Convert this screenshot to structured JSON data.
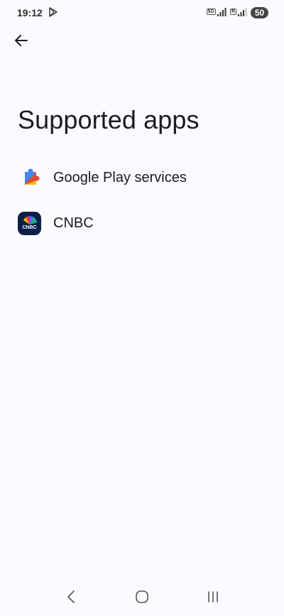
{
  "status_bar": {
    "time": "19:12",
    "network_tag_1": "5G",
    "network_tag_2": "R",
    "battery": "50",
    "icons": [
      "play-store-icon",
      "signal-icon",
      "battery-icon"
    ]
  },
  "header": {
    "back_icon": "arrow-left-icon"
  },
  "page": {
    "title": "Supported apps"
  },
  "apps": [
    {
      "label": "Google Play services",
      "icon": "google-play-services-icon"
    },
    {
      "label": "CNBC",
      "icon": "cnbc-icon",
      "icon_text": "CNBC"
    }
  ],
  "nav_bar": {
    "back_icon": "nav-back-icon",
    "home_icon": "nav-home-icon",
    "recents_icon": "nav-recents-icon"
  },
  "colors": {
    "background": "#fbfafe",
    "text": "#1d1b20",
    "cnbc_background": "#0b1f4a"
  }
}
